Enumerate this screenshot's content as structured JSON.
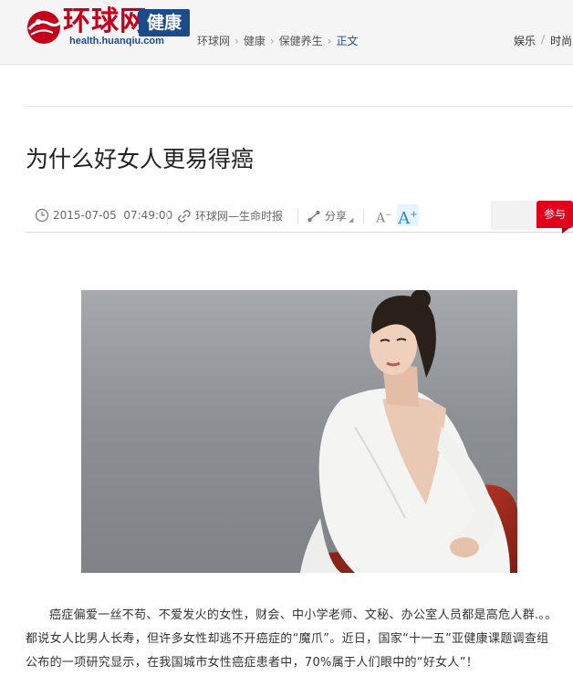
{
  "site": {
    "logo_text": "环球网",
    "channel": "健康",
    "domain": "health.huanqiu.com"
  },
  "breadcrumb": [
    "环球网",
    "健康",
    "保健养生",
    "正文"
  ],
  "topnav": [
    "娱乐",
    "时尚"
  ],
  "article": {
    "title": "为什么好女人更易得癌",
    "datetime": "2015-07-05  07:49:00",
    "source": "环球网—生命时报",
    "share_label": "分享",
    "font_small": "A",
    "font_large": "A",
    "join_label": "参与",
    "body": "癌症偏爱一丝不苟、不爱发火的女性，财会、中小学老师、文秘、办公室人员都是高危人群.。。都说女人比男人长寿，但许多女性却逃不开癌症的“魔爪”。近日，国家“十一五”亚健康课题调查组公布的一项研究显示，在我国城市女性癌症患者中，70%属于人们眼中的“好女人”！"
  },
  "colors": {
    "brand_red": "#c5001c",
    "brand_blue": "#1c4b8c",
    "join_red": "#e1031b"
  }
}
